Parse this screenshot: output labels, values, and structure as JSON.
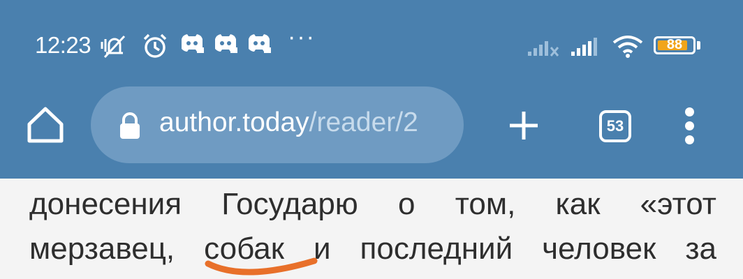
{
  "status_bar": {
    "time": "12:23",
    "notification_icons": [
      "mute-vibrate-icon",
      "alarm-icon",
      "discord-icon",
      "discord-icon",
      "discord-icon"
    ],
    "more_indicator": "···",
    "signal_icons": [
      "signal-sim1-icon",
      "signal-sim2-icon",
      "wifi-icon"
    ],
    "battery_level": "88",
    "battery_fraction": 0.88,
    "battery_color": "#f1a51b"
  },
  "toolbar": {
    "url_host": "author.today",
    "url_path": "/reader/2",
    "tab_count": "53",
    "accent": "#4a80ae"
  },
  "article": {
    "line1_words": [
      "донесения",
      "Государю",
      "о",
      "том,",
      "как",
      "«этот"
    ],
    "line2_words": [
      "мерзавец,",
      "собак",
      "и",
      "последний",
      "человек",
      "за"
    ],
    "annotation_color": "#e8702a"
  }
}
